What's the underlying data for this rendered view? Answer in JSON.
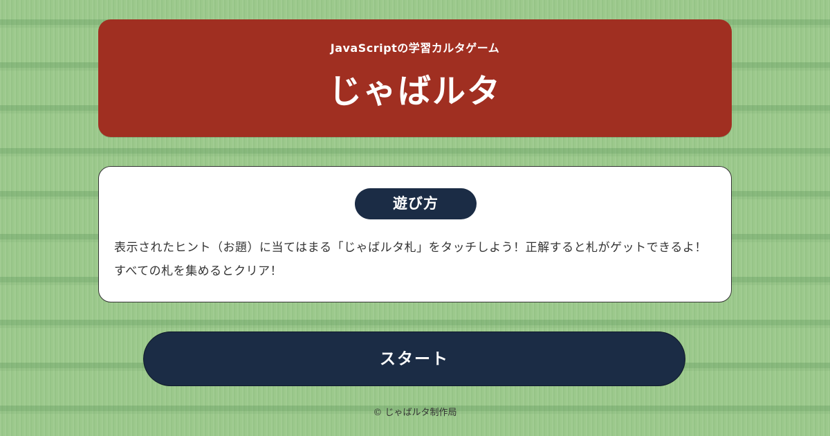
{
  "header": {
    "subtitle": "JavaScriptの学習カルタゲーム",
    "title": "じゃばルタ"
  },
  "howto": {
    "heading": "遊び方",
    "description": "表示されたヒント（お題）に当てはまる「じゃばルタ札」をタッチしよう！正解すると札がゲットできるよ！すべての札を集めるとクリア！"
  },
  "start_button": {
    "label": "スタート"
  },
  "footer": {
    "copyright": "© じゃばルタ制作局"
  },
  "colors": {
    "background": "#9cc98c",
    "header": "#a02f21",
    "navy": "#1b2c45",
    "card": "#ffffff",
    "text": "#333333"
  }
}
